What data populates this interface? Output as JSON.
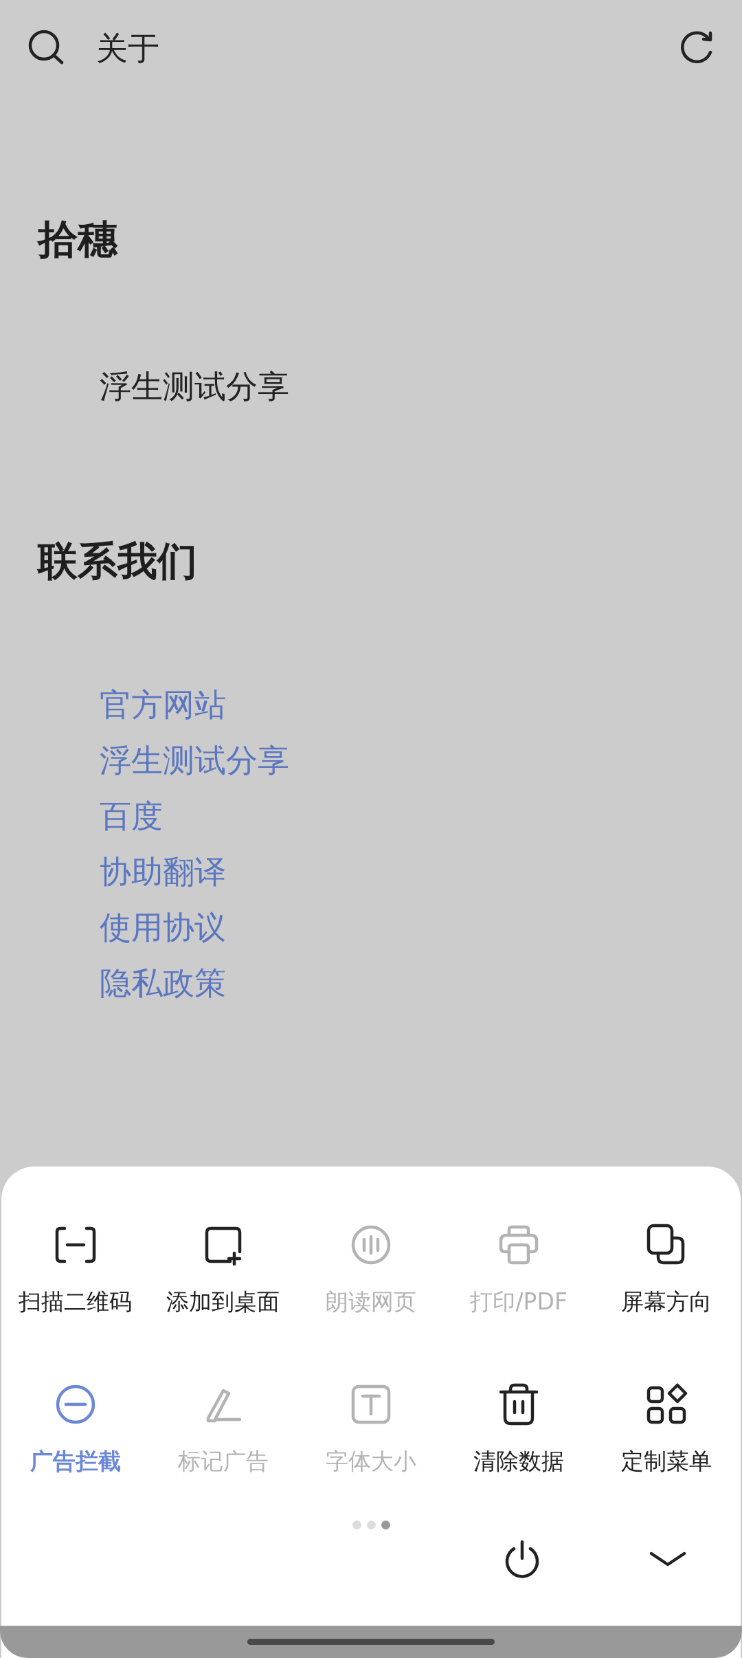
{
  "top_bar": {
    "title": "关于"
  },
  "sections": [
    {
      "heading": "拾穗",
      "lines": [
        {
          "text": "浮生测试分享",
          "link": false
        }
      ]
    },
    {
      "heading": "联系我们",
      "lines": [
        {
          "text": "官方网站",
          "link": true
        },
        {
          "text": "浮生测试分享",
          "link": true
        },
        {
          "text": "百度",
          "link": true
        },
        {
          "text": "协助翻译",
          "link": true
        },
        {
          "text": "使用协议",
          "link": true
        },
        {
          "text": "隐私政策",
          "link": true
        }
      ]
    }
  ],
  "menu": {
    "items": [
      {
        "label": "扫描二维码",
        "disabled": false,
        "on": false
      },
      {
        "label": "添加到桌面",
        "disabled": false,
        "on": false
      },
      {
        "label": "朗读网页",
        "disabled": true,
        "on": false
      },
      {
        "label": "打印/PDF",
        "disabled": true,
        "on": false
      },
      {
        "label": "屏幕方向",
        "disabled": false,
        "on": false
      },
      {
        "label": "广告拦截",
        "disabled": false,
        "on": true
      },
      {
        "label": "标记广告",
        "disabled": true,
        "on": false
      },
      {
        "label": "字体大小",
        "disabled": true,
        "on": false
      },
      {
        "label": "清除数据",
        "disabled": false,
        "on": false
      },
      {
        "label": "定制菜单",
        "disabled": false,
        "on": false
      }
    ],
    "pages": [
      {
        "selected": false
      },
      {
        "selected": false
      },
      {
        "selected": true
      }
    ]
  }
}
